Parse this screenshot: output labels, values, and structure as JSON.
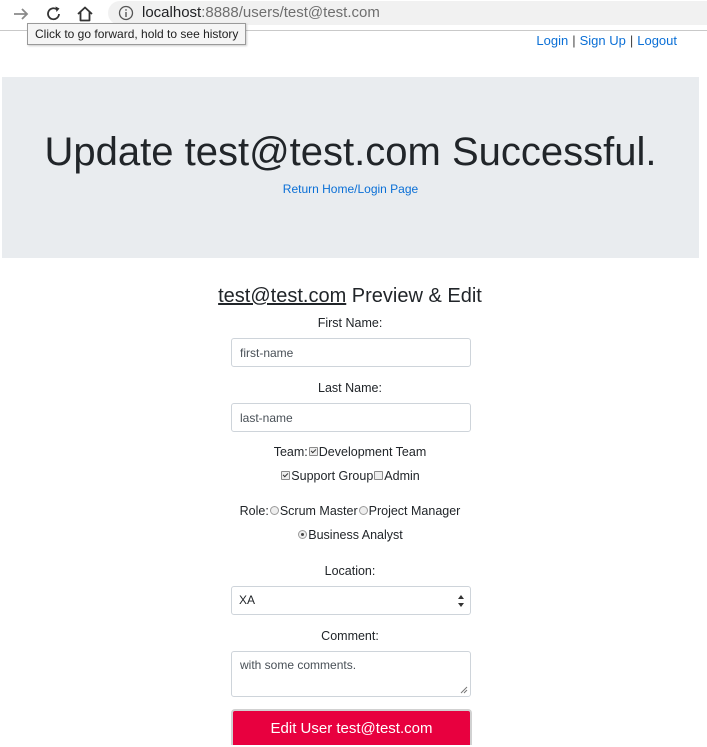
{
  "browser": {
    "url_host": "localhost",
    "url_rest": ":8888/users/test@test.com",
    "tooltip": "Click to go forward, hold to see history",
    "icons": [
      "forward-icon",
      "reload-icon",
      "home-icon",
      "info-icon"
    ]
  },
  "nav": {
    "login": "Login",
    "signup": "Sign Up",
    "logout": "Logout",
    "separator": "|"
  },
  "jumbotron": {
    "title": "Update test@test.com Successful.",
    "link": "Return Home/Login Page"
  },
  "form": {
    "heading_email": "test@test.com",
    "heading_suffix": " Preview & Edit",
    "first_name_label": "First Name:",
    "first_name_placeholder": "first-name",
    "last_name_label": "Last Name:",
    "last_name_placeholder": "last-name",
    "team_label": "Team:",
    "teams": [
      {
        "label": "Development Team",
        "checked": true
      },
      {
        "label": "Support Group",
        "checked": true
      },
      {
        "label": "Admin",
        "checked": false
      }
    ],
    "role_label": "Role:",
    "roles": [
      {
        "label": "Scrum Master",
        "checked": false
      },
      {
        "label": "Project Manager",
        "checked": false
      },
      {
        "label": "Business Analyst",
        "checked": true
      }
    ],
    "location_label": "Location:",
    "location_value": "XA",
    "comment_label": "Comment:",
    "comment_value": "with some comments.",
    "submit_label": "Edit User test@test.com"
  },
  "colors": {
    "link": "#0a6fd6",
    "jumbotron_bg": "#e9ecef",
    "submit_bg": "#e8003f"
  }
}
